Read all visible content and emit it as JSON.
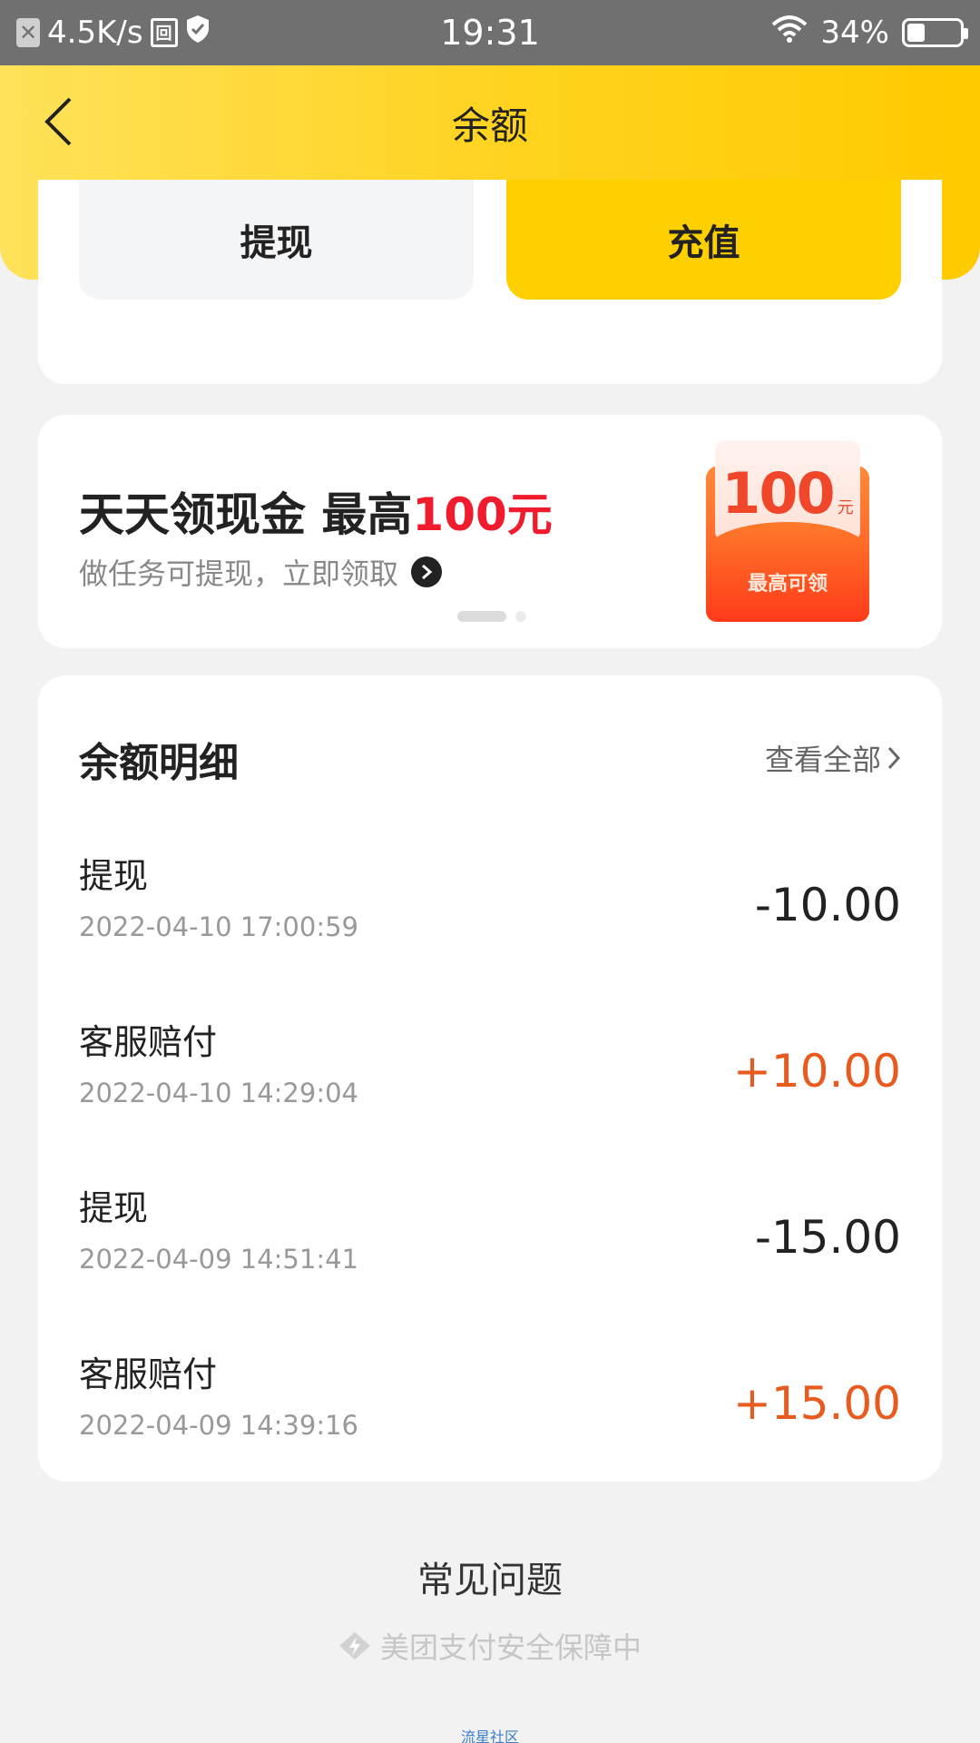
{
  "status_bar": {
    "speed": "4.5K/s",
    "time": "19:31",
    "battery": "34%",
    "battery_level": 0.34
  },
  "nav": {
    "title": "余额"
  },
  "actions": {
    "withdraw": "提现",
    "recharge": "充值"
  },
  "promo": {
    "title_main": "天天领现金 最高",
    "title_highlight": "100元",
    "subtitle": "做任务可提现，立即领取",
    "redpack_amount": "100",
    "redpack_unit": "元",
    "redpack_label": "最高可领"
  },
  "detail": {
    "title": "余额明细",
    "view_all": "查看全部",
    "transactions": [
      {
        "name": "提现",
        "time": "2022-04-10 17:00:59",
        "amount": "-10.00"
      },
      {
        "name": "客服赔付",
        "time": "2022-04-10 14:29:04",
        "amount": "+10.00"
      },
      {
        "name": "提现",
        "time": "2022-04-09 14:51:41",
        "amount": "-15.00"
      },
      {
        "name": "客服赔付",
        "time": "2022-04-09 14:39:16",
        "amount": "+15.00"
      }
    ]
  },
  "footer": {
    "faq": "常见问题",
    "safety": "美团支付安全保障中",
    "watermark": "流星社区"
  },
  "colors": {
    "brand_yellow": "#ffd000",
    "positive_amount": "#e85a1e",
    "promo_highlight": "#f01b2d"
  }
}
